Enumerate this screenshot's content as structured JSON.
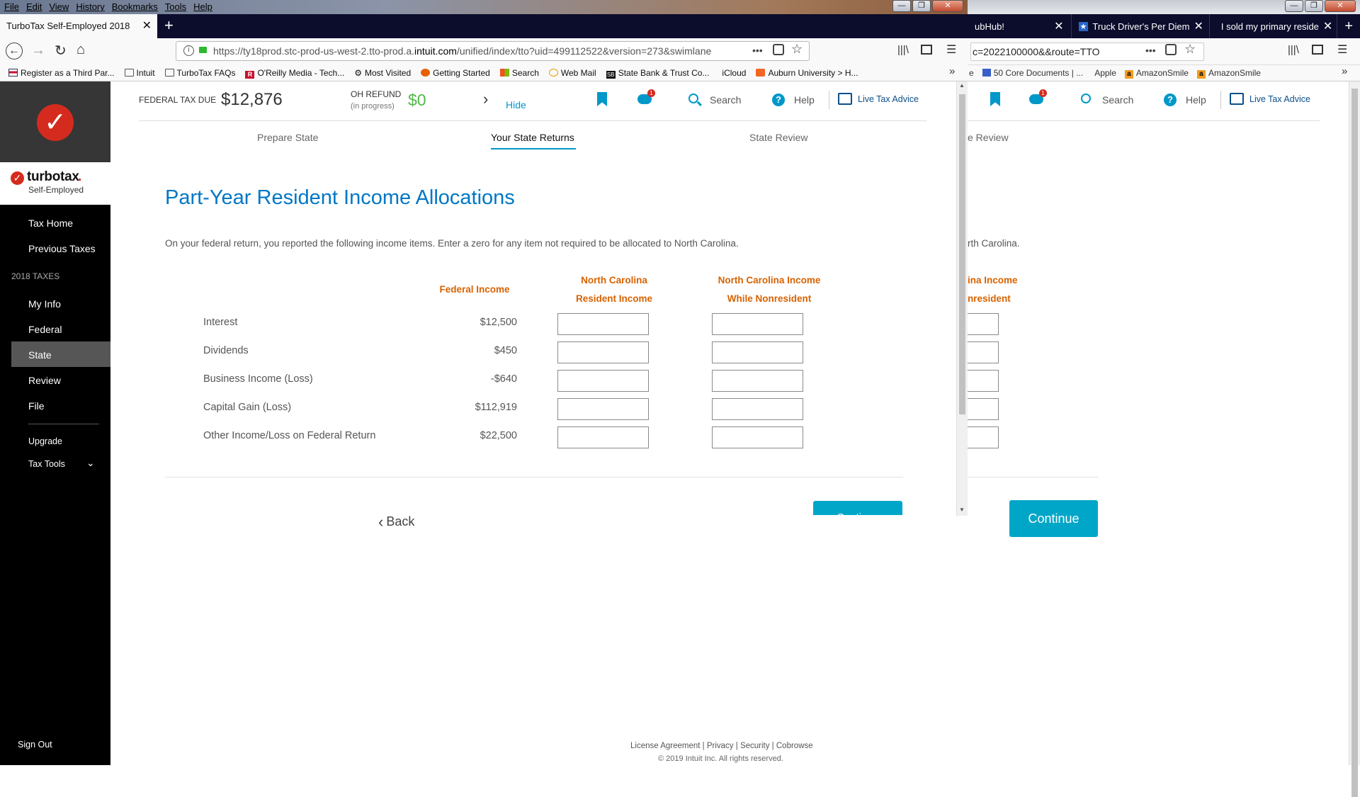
{
  "back_window": {
    "tabs": [
      {
        "label": "ubHub!"
      },
      {
        "label": "Truck Driver's Per Diem"
      },
      {
        "label": "I sold my primary reside"
      }
    ],
    "url": "c=2022100000&&route=TTO",
    "bookmarks": [
      "e",
      "50 Core Documents | ...",
      "Apple",
      "AmazonSmile",
      "AmazonSmile"
    ],
    "nav_search": "Search",
    "nav_help": "Help",
    "nav_live": "Live Tax Advice",
    "step_partial": "e Review",
    "desc_partial": "rth Carolina.",
    "col_partial_line1": "ina Income",
    "col_partial_line2": "nresident",
    "continue_label": "Continue",
    "footer_links": [
      "License Agreement",
      "Privacy",
      "Security",
      "Cobrowse"
    ],
    "footer_copyright": "© 2019 Intuit Inc. All rights reserved."
  },
  "menu": [
    "File",
    "Edit",
    "View",
    "History",
    "Bookmarks",
    "Tools",
    "Help"
  ],
  "tab": {
    "title": "TurboTax Self-Employed 2018"
  },
  "url": {
    "prefix": "https://ty18prod.stc-prod-us-west-2.tto-prod.a.",
    "domain": "intuit.com",
    "rest": "/unified/index/tto?uid=499112522&version=273&swimlane"
  },
  "bookmarks": [
    "Register as a Third Par...",
    "Intuit",
    "TurboTax FAQs",
    "O'Reilly Media - Tech...",
    "Most Visited",
    "Getting Started",
    "Search",
    "Web Mail",
    "State Bank & Trust Co...",
    "iCloud",
    "Auburn University > H..."
  ],
  "brand": {
    "name": "turbotax",
    "edition": "Self-Employed"
  },
  "sidebar": {
    "items_top": [
      "Tax Home",
      "Previous Taxes"
    ],
    "section": "2018 TAXES",
    "items": [
      "My Info",
      "Federal",
      "State",
      "Review",
      "File"
    ],
    "selected": "State",
    "upgrade": "Upgrade",
    "tools": "Tax Tools",
    "signout": "Sign Out"
  },
  "header": {
    "fed_label": "FEDERAL TAX DUE",
    "fed_value": "$12,876",
    "state_label": "OH REFUND",
    "state_sub": "(in progress)",
    "state_value": "$0",
    "hide": "Hide",
    "badge": "1",
    "search": "Search",
    "help": "Help",
    "live": "Live Tax Advice"
  },
  "steps": [
    "Prepare State",
    "Your State Returns",
    "State Review"
  ],
  "page": {
    "title": "Part-Year Resident Income Allocations",
    "description": "On your federal return, you reported the following income items. Enter a zero for any item not required to be allocated to North Carolina.",
    "columns": {
      "federal": "Federal Income",
      "resident_line1": "North Carolina",
      "resident_line2": "Resident Income",
      "nonres_line1": "North Carolina Income",
      "nonres_line2": "While Nonresident"
    },
    "rows": [
      {
        "label": "Interest",
        "value": "$12,500"
      },
      {
        "label": "Dividends",
        "value": "$450"
      },
      {
        "label": "Business Income (Loss)",
        "value": "-$640"
      },
      {
        "label": "Capital Gain (Loss)",
        "value": "$112,919"
      },
      {
        "label": "Other Income/Loss on Federal Return",
        "value": "$22,500"
      }
    ],
    "back": "Back",
    "continue_partial": "Continue"
  },
  "colors": {
    "accent": "#0098c9",
    "title_blue": "#0077c5",
    "column_orange": "#d86200",
    "refund_green": "#52b848",
    "continue_teal": "#00a6c8",
    "brand_red": "#d52b1e"
  }
}
